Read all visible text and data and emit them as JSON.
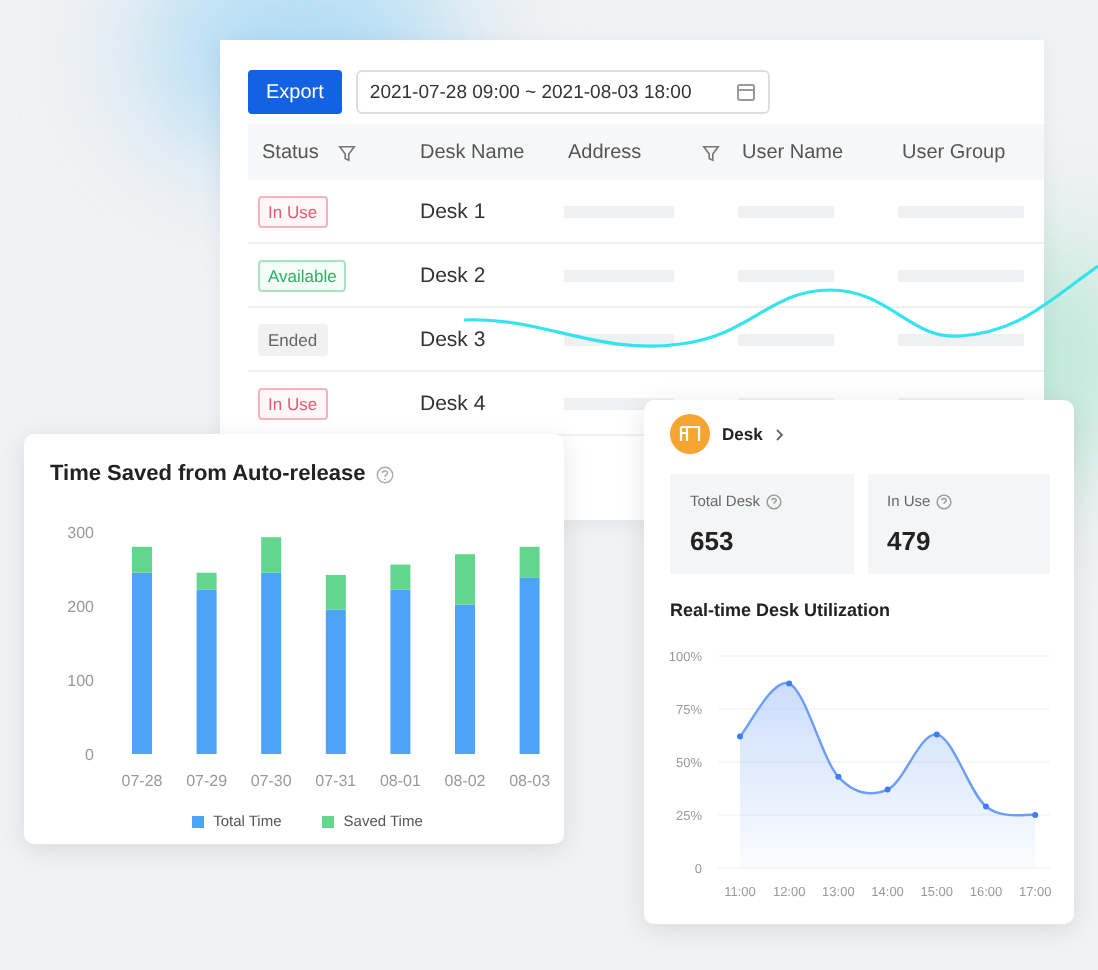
{
  "toolbar": {
    "export_button": "Export",
    "date_range": "2021-07-28 09:00 ~ 2021-08-03 18:00"
  },
  "table": {
    "columns": [
      {
        "label": "Status",
        "filter": true
      },
      {
        "label": "Desk Name",
        "filter": false
      },
      {
        "label": "Address",
        "filter": true
      },
      {
        "label": "User Name",
        "filter": false
      },
      {
        "label": "User Group",
        "filter": false
      }
    ],
    "rows": [
      {
        "status": {
          "label": "In Use",
          "kind": "in_use"
        },
        "desk_name": "Desk 1"
      },
      {
        "status": {
          "label": "Available",
          "kind": "available"
        },
        "desk_name": "Desk 2"
      },
      {
        "status": {
          "label": "Ended",
          "kind": "ended"
        },
        "desk_name": "Desk 3"
      },
      {
        "status": {
          "label": "In Use",
          "kind": "in_use"
        },
        "desk_name": "Desk 4"
      }
    ]
  },
  "time_saved_card": {
    "title": "Time Saved from Auto-release",
    "chart_data": {
      "type": "bar",
      "stacked": true,
      "categories": [
        "07-28",
        "07-29",
        "07-30",
        "07-31",
        "08-01",
        "08-02",
        "08-03"
      ],
      "ylim": [
        0,
        300
      ],
      "yticks": [
        0,
        100,
        200,
        300
      ],
      "series": [
        {
          "name": "Total Time",
          "color": "#4da3f7",
          "values": [
            245,
            222,
            245,
            195,
            222,
            202,
            238
          ]
        },
        {
          "name": "Saved Time",
          "color": "#62d68c",
          "values": [
            35,
            23,
            48,
            47,
            34,
            68,
            42
          ]
        }
      ]
    }
  },
  "desk_card": {
    "title": "Desk",
    "stats": [
      {
        "label": "Total Desk",
        "value": "653"
      },
      {
        "label": "In Use",
        "value": "479"
      }
    ],
    "utilization": {
      "title": "Real-time Desk Utilization",
      "chart_data": {
        "type": "area",
        "categories": [
          "11:00",
          "12:00",
          "13:00",
          "14:00",
          "15:00",
          "16:00",
          "17:00"
        ],
        "ylim": [
          0,
          100
        ],
        "yticks": [
          {
            "value": 0,
            "label": "0"
          },
          {
            "value": 25,
            "label": "25%"
          },
          {
            "value": 50,
            "label": "50%"
          },
          {
            "value": 75,
            "label": "75%"
          },
          {
            "value": 100,
            "label": "100%"
          }
        ],
        "grid": true,
        "series": [
          {
            "color": "#6b9ef5",
            "values": [
              62,
              87,
              43,
              37,
              63,
              29,
              25
            ]
          }
        ]
      }
    }
  }
}
